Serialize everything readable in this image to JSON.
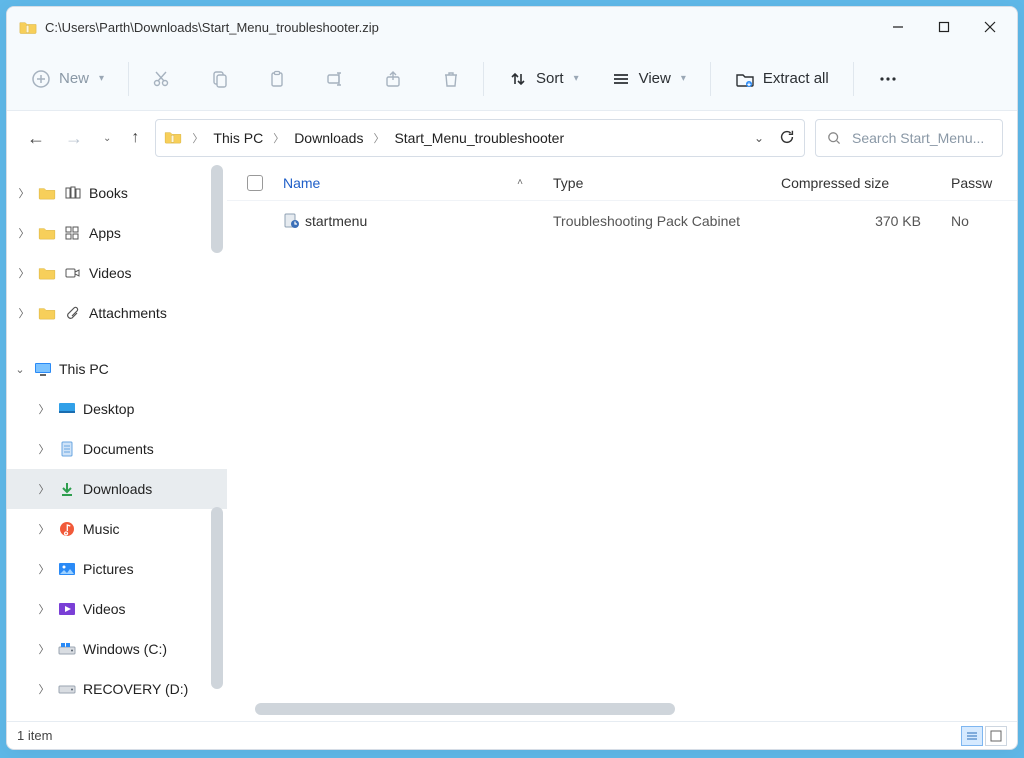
{
  "title": "C:\\Users\\Parth\\Downloads\\Start_Menu_troubleshooter.zip",
  "toolbar": {
    "new": "New",
    "sort": "Sort",
    "view": "View",
    "extract": "Extract all"
  },
  "breadcrumb": {
    "root": "This PC",
    "mid": "Downloads",
    "leaf": "Start_Menu_troubleshooter"
  },
  "search": {
    "placeholder": "Search Start_Menu..."
  },
  "sidebar": {
    "quick": [
      {
        "label": "Books"
      },
      {
        "label": "Apps"
      },
      {
        "label": "Videos"
      },
      {
        "label": "Attachments"
      }
    ],
    "thispc_label": "This PC",
    "thispc": [
      {
        "label": "Desktop"
      },
      {
        "label": "Documents"
      },
      {
        "label": "Downloads",
        "selected": true
      },
      {
        "label": "Music"
      },
      {
        "label": "Pictures"
      },
      {
        "label": "Videos"
      },
      {
        "label": "Windows (C:)"
      },
      {
        "label": "RECOVERY (D:)"
      }
    ]
  },
  "columns": {
    "name": "Name",
    "type": "Type",
    "size": "Compressed size",
    "pass": "Password ..."
  },
  "files": [
    {
      "name": "startmenu",
      "type": "Troubleshooting Pack Cabinet",
      "size": "370 KB",
      "pass": "No"
    }
  ],
  "status": {
    "count": "1 item"
  }
}
